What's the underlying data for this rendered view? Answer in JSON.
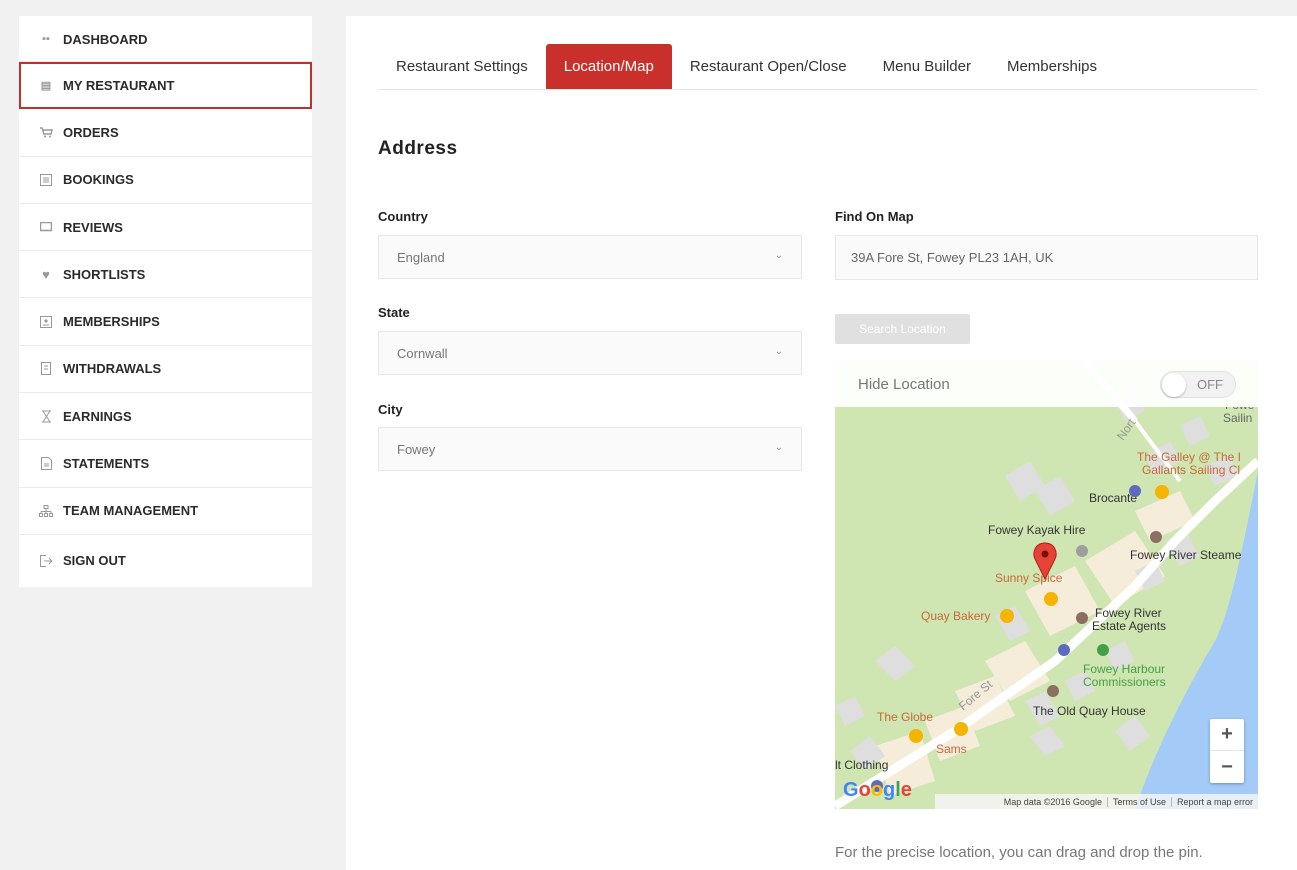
{
  "sidebar": {
    "items": [
      {
        "label": "DASHBOARD",
        "icon": "dashboard-icon"
      },
      {
        "label": "MY RESTAURANT",
        "icon": "restaurant-icon"
      },
      {
        "label": "ORDERS",
        "icon": "cart-icon"
      },
      {
        "label": "BOOKINGS",
        "icon": "bookings-icon"
      },
      {
        "label": "REVIEWS",
        "icon": "reviews-icon"
      },
      {
        "label": "SHORTLISTS",
        "icon": "heart-icon"
      },
      {
        "label": "MEMBERSHIPS",
        "icon": "memberships-icon"
      },
      {
        "label": "WITHDRAWALS",
        "icon": "withdrawals-icon"
      },
      {
        "label": "EARNINGS",
        "icon": "earnings-icon"
      },
      {
        "label": "STATEMENTS",
        "icon": "statements-icon"
      },
      {
        "label": "TEAM MANAGEMENT",
        "icon": "team-icon"
      },
      {
        "label": "SIGN OUT",
        "icon": "sign-out-icon"
      }
    ],
    "active_index": 1
  },
  "tabs": [
    {
      "label": "Restaurant Settings"
    },
    {
      "label": "Location/Map"
    },
    {
      "label": "Restaurant Open/Close"
    },
    {
      "label": "Menu Builder"
    },
    {
      "label": "Memberships"
    }
  ],
  "active_tab": 1,
  "address": {
    "heading": "Address",
    "country_label": "Country",
    "country_value": "England",
    "state_label": "State",
    "state_value": "Cornwall",
    "city_label": "City",
    "city_value": "Fowey",
    "find_label": "Find On Map",
    "find_value": "39A Fore St, Fowey PL23 1AH, UK",
    "search_button": "Search Location"
  },
  "map": {
    "hide_label": "Hide Location",
    "toggle_state": "OFF",
    "zoom_in": "+",
    "zoom_out": "−",
    "logo": "Google",
    "footer": [
      "Map data ©2016 Google",
      "Terms of Use",
      "Report a map error"
    ],
    "places": {
      "north": "Nort",
      "fowey": "Fowe",
      "sailing": "Sailin",
      "galley1": "The Galley @ The I",
      "galley2": "Gallants Sailing Cl",
      "brocante": "Brocante",
      "kayak": "Fowey Kayak Hire",
      "steamer": "Fowey River Steame",
      "sunny": "Sunny Spice",
      "quay": "Quay Bakery",
      "estate1": "Fowey River",
      "estate2": "Estate Agents",
      "harbour1": "Fowey Harbour",
      "harbour2": "Commissioners",
      "foresst": "Fore St",
      "oldquay": "The Old Quay House",
      "globe": "The Globe",
      "sams": "Sams",
      "clothing": "lt Clothing"
    },
    "colors": {
      "water": "#a4cbf8",
      "land": "#cfe6b2",
      "road": "#ffffff",
      "pin": "#e44336"
    }
  },
  "note": "For the precise location, you can drag and drop the pin."
}
